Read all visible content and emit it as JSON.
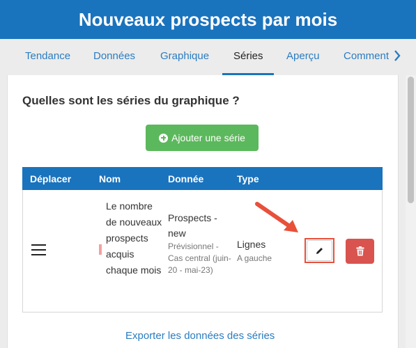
{
  "header": {
    "title": "Nouveaux prospects par mois"
  },
  "tabs": [
    {
      "label": "Tendance"
    },
    {
      "label": "Données"
    },
    {
      "label": "Graphique"
    },
    {
      "label": "Séries"
    },
    {
      "label": "Aperçu"
    },
    {
      "label": "Comment"
    }
  ],
  "active_tab": "Séries",
  "main": {
    "question": "Quelles sont les séries du graphique ?",
    "add_button": "Ajouter une série",
    "table": {
      "headers": [
        "Déplacer",
        "Nom",
        "Donnée",
        "Type"
      ],
      "rows": [
        {
          "name": "Le nombre de nouveaux prospects acquis chaque mois",
          "color": "#f4a0a0",
          "data_title": "Prospects - new",
          "data_sub": "Prévisionnel - Cas central (juin-20 - mai-23)",
          "type_title": "Lignes",
          "type_sub": "A gauche"
        }
      ]
    },
    "export_link": "Exporter les données des séries"
  },
  "colors": {
    "header_blue": "#1a73bd",
    "link_blue": "#2a7cc0",
    "add_green": "#5cb85c",
    "delete_red": "#d9534f",
    "highlight_orange": "#e8503a"
  },
  "icons": {
    "add": "plus-circle-icon",
    "drag": "hamburger-icon",
    "edit": "pencil-icon",
    "delete": "trash-icon",
    "next": "chevron-right-icon"
  }
}
